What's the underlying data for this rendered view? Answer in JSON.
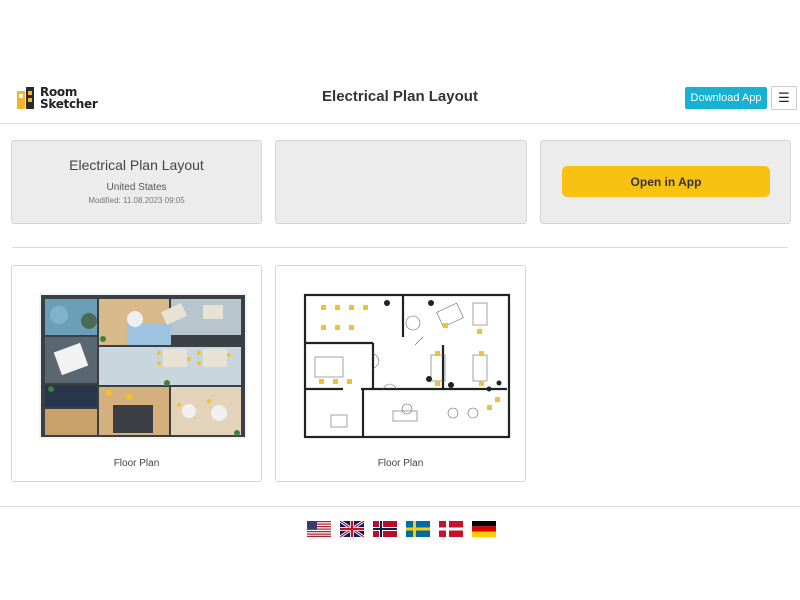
{
  "header": {
    "logo_line1": "Room",
    "logo_line2": "Sketcher",
    "title": "Electrical Plan Layout",
    "download_label": "Download App",
    "menu_icon": "☰"
  },
  "info_card": {
    "title": "Electrical Plan Layout",
    "country": "United States",
    "modified": "Modified: 11.08.2023 09:05"
  },
  "open_card": {
    "button_label": "Open in App"
  },
  "plans": [
    {
      "caption": "Floor Plan",
      "view": "3D"
    },
    {
      "caption": "Floor Plan",
      "view": "2D"
    }
  ],
  "languages": [
    {
      "name": "us-flag-icon"
    },
    {
      "name": "uk-flag-icon"
    },
    {
      "name": "norway-flag-icon"
    },
    {
      "name": "sweden-flag-icon"
    },
    {
      "name": "denmark-flag-icon"
    },
    {
      "name": "germany-flag-icon"
    }
  ],
  "colors": {
    "accent_cyan": "#17b1d3",
    "open_yellow": "#f9c213",
    "card_gray": "#ececec"
  }
}
